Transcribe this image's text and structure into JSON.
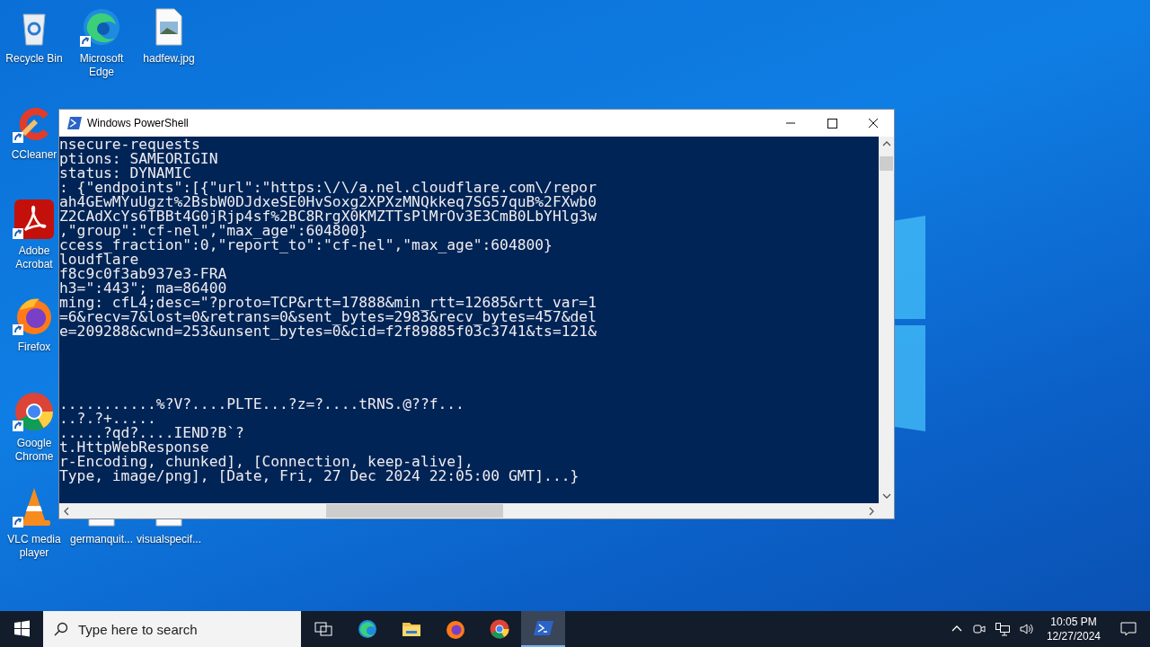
{
  "desktop_icons": [
    {
      "label": "Recycle Bin",
      "kind": "recycle-bin",
      "shortcut": false
    },
    {
      "label": "Microsoft Edge",
      "kind": "edge",
      "shortcut": true
    },
    {
      "label": "hadfew.jpg",
      "kind": "image-file",
      "shortcut": false
    },
    {
      "label": "CCleaner",
      "kind": "ccleaner",
      "shortcut": true
    },
    {
      "label": "Adobe Acrobat",
      "kind": "acrobat",
      "shortcut": true
    },
    {
      "label": "Firefox",
      "kind": "firefox",
      "shortcut": true
    },
    {
      "label": "Google Chrome",
      "kind": "chrome",
      "shortcut": true
    },
    {
      "label": "VLC media player",
      "kind": "vlc",
      "shortcut": true
    },
    {
      "label": "germanquit...",
      "kind": "document",
      "shortcut": false
    },
    {
      "label": "visualspecif...",
      "kind": "document",
      "shortcut": false
    }
  ],
  "window": {
    "title": "Windows PowerShell",
    "output_blocks": [
      [
        "nsecure-requests",
        "ptions: SAMEORIGIN",
        "status: DYNAMIC",
        ": {\"endpoints\":[{\"url\":\"https:\\/\\/a.nel.cloudflare.com\\/repor",
        "ah4GEwMYuUgzt%2BsbW0DJdxeSE0HvSoxg2XPXzMNQkkeq7SG57quB%2FXwb0",
        "Z2CAdXcYs6TBBt4G0jRjp4sf%2BC8RrgX0KMZTTsPlMrOv3E3CmB0LbYHlg3w",
        ",\"group\":\"cf-nel\",\"max_age\":604800}",
        "ccess_fraction\":0,\"report_to\":\"cf-nel\",\"max_age\":604800}",
        "loudflare",
        "f8c9c0f3ab937e3-FRA",
        "h3=\":443\"; ma=86400",
        "ming: cfL4;desc=\"?proto=TCP&rtt=17888&min_rtt=12685&rtt_var=1",
        "=6&recv=7&lost=0&retrans=0&sent_bytes=2983&recv_bytes=457&del",
        "e=209288&cwnd=253&unsent_bytes=0&cid=f2f89885f03c3741&ts=121&"
      ],
      [
        "...........%?V?....PLTE...?z=?....tRNS.@??f...",
        "..?.?+.....",
        ".....?qd?....IEND?B`?",
        "t.HttpWebResponse",
        "r-Encoding, chunked], [Connection, keep-alive],",
        "Type, image/png], [Date, Fri, 27 Dec 2024 22:05:00 GMT]...}"
      ]
    ]
  },
  "taskbar": {
    "search": {
      "placeholder": "Type here to search"
    },
    "apps": [
      {
        "kind": "task-view",
        "selected": false
      },
      {
        "kind": "edge",
        "selected": false
      },
      {
        "kind": "explorer",
        "selected": false
      },
      {
        "kind": "firefox",
        "selected": false
      },
      {
        "kind": "chrome",
        "selected": false
      },
      {
        "kind": "powershell",
        "selected": true
      }
    ],
    "time": "10:05 PM",
    "date": "12/27/2024"
  }
}
